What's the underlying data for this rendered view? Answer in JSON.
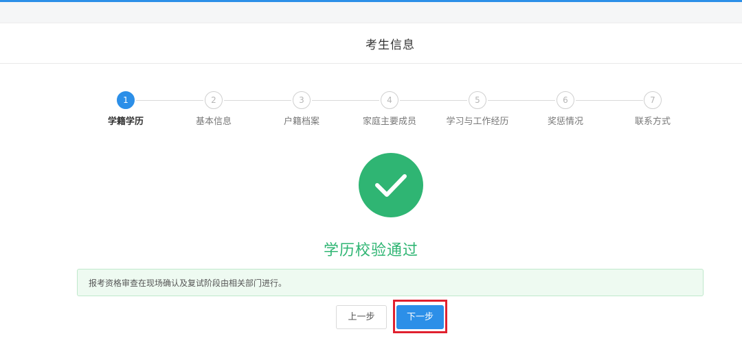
{
  "header": {
    "title": "考生信息"
  },
  "steps": [
    {
      "number": "1",
      "label": "学籍学历",
      "active": true
    },
    {
      "number": "2",
      "label": "基本信息",
      "active": false
    },
    {
      "number": "3",
      "label": "户籍档案",
      "active": false
    },
    {
      "number": "4",
      "label": "家庭主要成员",
      "active": false
    },
    {
      "number": "5",
      "label": "学习与工作经历",
      "active": false
    },
    {
      "number": "6",
      "label": "奖惩情况",
      "active": false
    },
    {
      "number": "7",
      "label": "联系方式",
      "active": false
    }
  ],
  "result": {
    "icon": "check-circle-icon",
    "message": "学历校验通过"
  },
  "notice": {
    "text": "报考资格审查在现场确认及复试阶段由相关部门进行。"
  },
  "actions": {
    "prev_label": "上一步",
    "next_label": "下一步"
  },
  "colors": {
    "primary": "#2c8fe8",
    "success": "#2fb573",
    "highlight": "#e0202e"
  }
}
